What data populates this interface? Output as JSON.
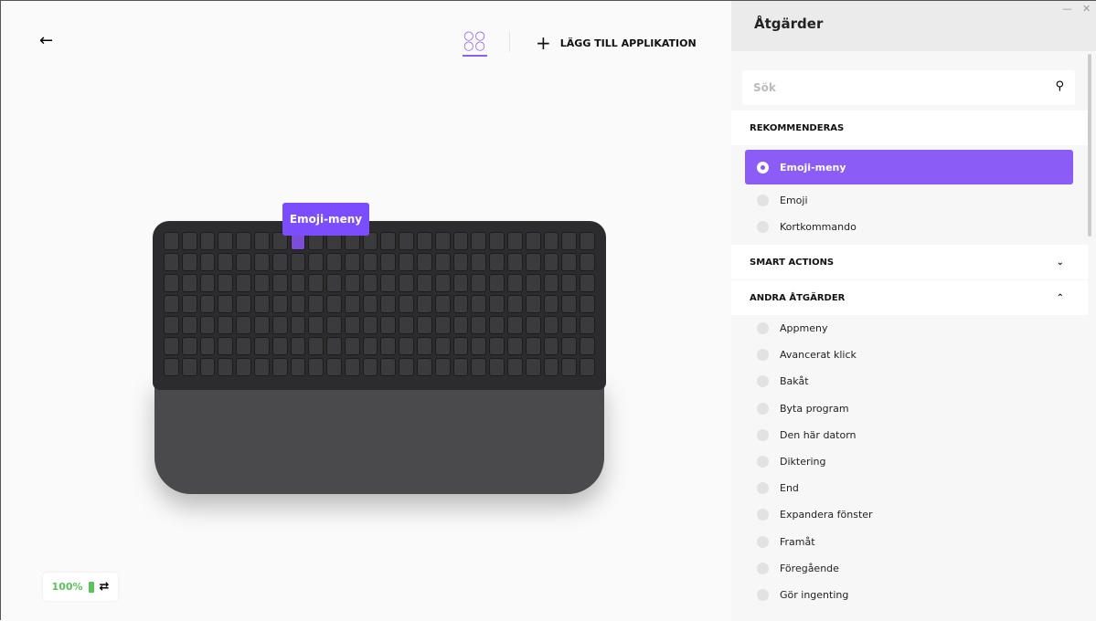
{
  "header": {
    "add_app_label": "LÄGG TILL APPLIKATION"
  },
  "keyboard": {
    "tooltip": "Emoji-meny"
  },
  "status": {
    "battery": "100%",
    "battery_color": "#5ac35a"
  },
  "panel": {
    "title": "Åtgärder",
    "search_placeholder": "Sök",
    "recommended_label": "REKOMMENDERAS",
    "recommended": [
      {
        "label": "Emoji-meny",
        "selected": true
      },
      {
        "label": "Emoji"
      },
      {
        "label": "Kortkommando"
      }
    ],
    "smart_actions_label": "SMART ACTIONS",
    "other_label": "ANDRA ÅTGÄRDER",
    "other": [
      "Appmeny",
      "Avancerat klick",
      "Bakåt",
      "Byta program",
      "Den här datorn",
      "Diktering",
      "End",
      "Expandera fönster",
      "Framåt",
      "Föregående",
      "Gör ingenting"
    ]
  },
  "accent": "#8b5cf6"
}
